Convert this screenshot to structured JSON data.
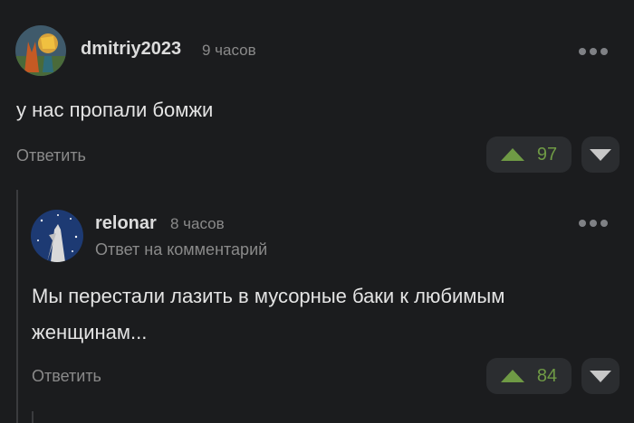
{
  "comment1": {
    "username": "dmitriy2023",
    "time": "9 часов",
    "text": "у нас пропали бомжи",
    "reply_label": "Ответить",
    "votes": "97"
  },
  "comment2": {
    "username": "relonar",
    "time": "8 часов",
    "subtitle": "Ответ на комментарий",
    "text_line1": "Мы перестали лазить в мусорные баки к любимым",
    "text_line2": "женщинам...",
    "reply_label": "Ответить",
    "votes": "84"
  },
  "colors": {
    "background": "#1b1c1e",
    "vote_green": "#6f9a45",
    "button_bg": "#2b2d30"
  },
  "icons": {
    "more": "more-dots-icon",
    "upvote": "upvote-arrow-icon",
    "downvote": "downvote-arrow-icon"
  }
}
